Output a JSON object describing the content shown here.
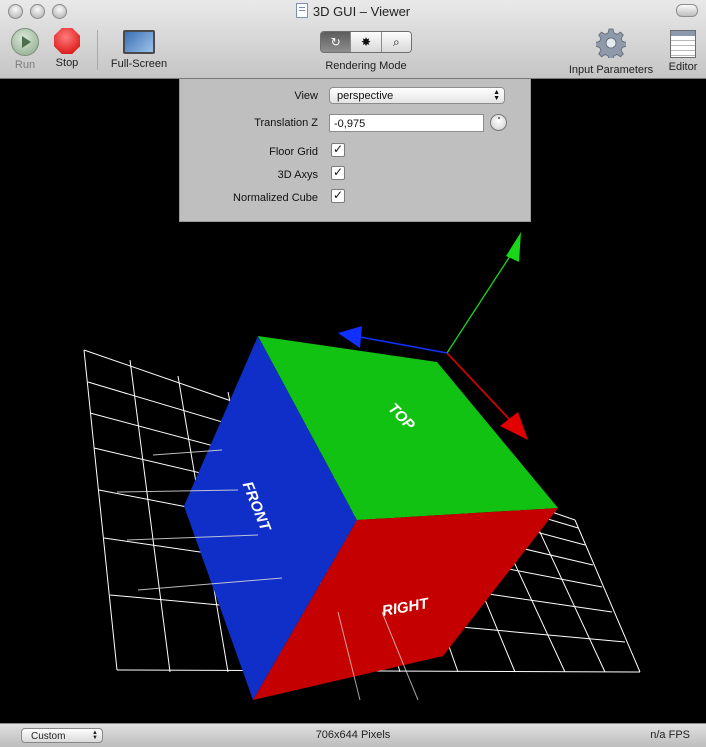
{
  "window": {
    "title": "3D GUI – Viewer"
  },
  "toolbar": {
    "run_label": "Run",
    "stop_label": "Stop",
    "fullscreen_label": "Full-Screen",
    "rendering_mode_label": "Rendering Mode",
    "rendering_mode_options": [
      "↻",
      "✸",
      "⌕"
    ],
    "input_parameters_label": "Input Parameters",
    "editor_label": "Editor"
  },
  "parameters": {
    "view_label": "View",
    "view_value": "perspective",
    "translation_label": "Translation Z",
    "translation_value": "-0,975",
    "floor_grid_label": "Floor Grid",
    "axys_label": "3D Axys",
    "normalized_cube_label": "Normalized Cube",
    "floor_grid_checked": true,
    "axys_checked": true,
    "normalized_cube_checked": true
  },
  "scene": {
    "face_top": "TOP",
    "face_front": "FRONT",
    "face_right": "RIGHT",
    "colors": {
      "top": "#12c212",
      "front": "#0f2fc8",
      "right": "#c40000",
      "axis_x": "#e00000",
      "axis_y": "#19d619",
      "axis_z": "#1030ff"
    }
  },
  "status": {
    "size_select_value": "Custom",
    "pixels": "706x644 Pixels",
    "fps": "n/a FPS"
  }
}
